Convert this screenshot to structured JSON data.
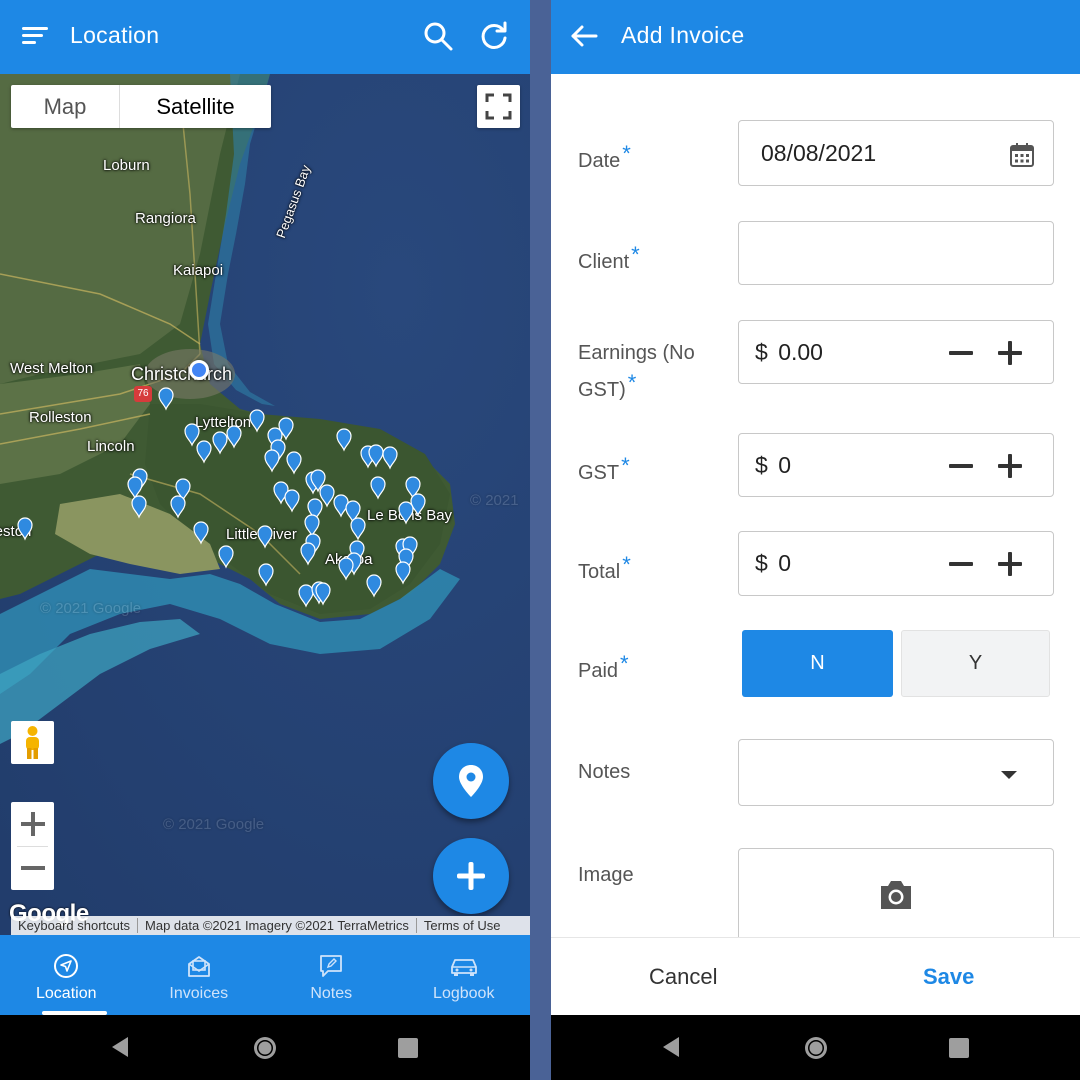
{
  "location_screen": {
    "title": "Location",
    "map_toggle": {
      "map_label": "Map",
      "satellite_label": "Satellite",
      "selected": "Satellite"
    },
    "place_labels": [
      "Loburn",
      "Rangiora",
      "Kaiapoi",
      "Pegasus Bay",
      "West Melton",
      "Christchurch",
      "Rolleston",
      "Lyttelton",
      "Lincoln",
      "Leeston",
      "Little River",
      "Le Bons Bay",
      "Akaroa",
      "76"
    ],
    "watermarks": [
      "© 2021 Google",
      "© 2021 Google",
      "© 2021"
    ],
    "google_logo": "Google",
    "attribution": [
      "Keyboard shortcuts",
      "Map data ©2021 Imagery ©2021 TerraMetrics",
      "Terms of Use"
    ],
    "bottom_nav": [
      {
        "label": "Location",
        "icon": "navigation-icon",
        "active": true
      },
      {
        "label": "Invoices",
        "icon": "invoice-icon",
        "active": false
      },
      {
        "label": "Notes",
        "icon": "note-edit-icon",
        "active": false
      },
      {
        "label": "Logbook",
        "icon": "car-icon",
        "active": false
      }
    ],
    "accent_color": "#1e88e5"
  },
  "invoice_screen": {
    "title": "Add Invoice",
    "required_marker": "*",
    "fields": {
      "date": {
        "label": "Date",
        "value": "08/08/2021"
      },
      "client": {
        "label": "Client",
        "value": ""
      },
      "earnings": {
        "label": "Earnings (No GST)",
        "label_line1": "Earnings (No",
        "label_line2": "GST)",
        "currency": "$",
        "value": "0.00"
      },
      "gst": {
        "label": "GST",
        "currency": "$",
        "value": "0"
      },
      "total": {
        "label": "Total",
        "currency": "$",
        "value": "0"
      },
      "paid": {
        "label": "Paid",
        "options": [
          "N",
          "Y"
        ],
        "selected": "N"
      },
      "notes": {
        "label": "Notes",
        "value": ""
      },
      "image": {
        "label": "Image"
      }
    },
    "cancel_label": "Cancel",
    "save_label": "Save"
  }
}
